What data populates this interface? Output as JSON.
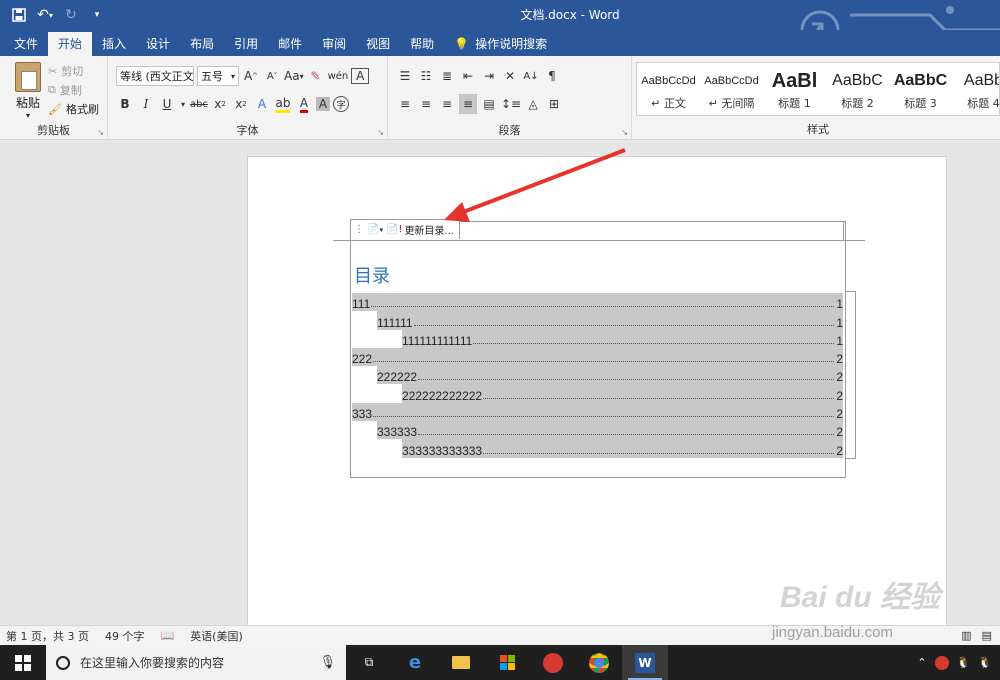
{
  "titlebar": {
    "title": "文档.docx  -  Word",
    "accent": "#2b579a"
  },
  "tabs": [
    {
      "label": "文件"
    },
    {
      "label": "开始",
      "active": true
    },
    {
      "label": "插入"
    },
    {
      "label": "设计"
    },
    {
      "label": "布局"
    },
    {
      "label": "引用"
    },
    {
      "label": "邮件"
    },
    {
      "label": "审阅"
    },
    {
      "label": "视图"
    },
    {
      "label": "帮助"
    },
    {
      "label": "操作说明搜索"
    }
  ],
  "clipboard": {
    "paste": "粘贴",
    "cut": "剪切",
    "copy": "复制",
    "format_painter": "格式刷",
    "group": "剪贴板"
  },
  "font": {
    "name": "等线 (西文正文",
    "size": "五号",
    "case_btn": "Aa",
    "group": "字体"
  },
  "paragraph": {
    "group": "段落"
  },
  "styles": {
    "group": "样式",
    "items": [
      {
        "sample": "AaBbCcDd",
        "name": "↵ 正文"
      },
      {
        "sample": "AaBbCcDd",
        "name": "↵ 无间隔"
      },
      {
        "sample": "AaBl",
        "name": "标题 1"
      },
      {
        "sample": "AaBbC",
        "name": "标题 2"
      },
      {
        "sample": "AaBbC",
        "name": "标题 3"
      },
      {
        "sample": "AaBb",
        "name": "标题 4"
      }
    ]
  },
  "toc": {
    "update_label": "更新目录...",
    "title": "目录",
    "title_color": "#2e74b5",
    "entries": [
      {
        "text": "111",
        "page": "1",
        "level": 1
      },
      {
        "text": "111111",
        "page": "1",
        "level": 2
      },
      {
        "text": "111111111111",
        "page": "1",
        "level": 3
      },
      {
        "text": "222",
        "page": "2",
        "level": 1
      },
      {
        "text": "222222",
        "page": "2",
        "level": 2
      },
      {
        "text": "222222222222",
        "page": "2",
        "level": 3
      },
      {
        "text": "333",
        "page": "2",
        "level": 1
      },
      {
        "text": "333333",
        "page": "2",
        "level": 2
      },
      {
        "text": "333333333333",
        "page": "2",
        "level": 3
      }
    ]
  },
  "status": {
    "page": "第 1 页，共 3 页",
    "words": "49 个字",
    "language": "英语(美国)"
  },
  "taskbar": {
    "search_placeholder": "在这里输入你要搜索的内容"
  },
  "watermark": {
    "brand": "Bai du 经验",
    "url": "jingyan.baidu.com"
  }
}
